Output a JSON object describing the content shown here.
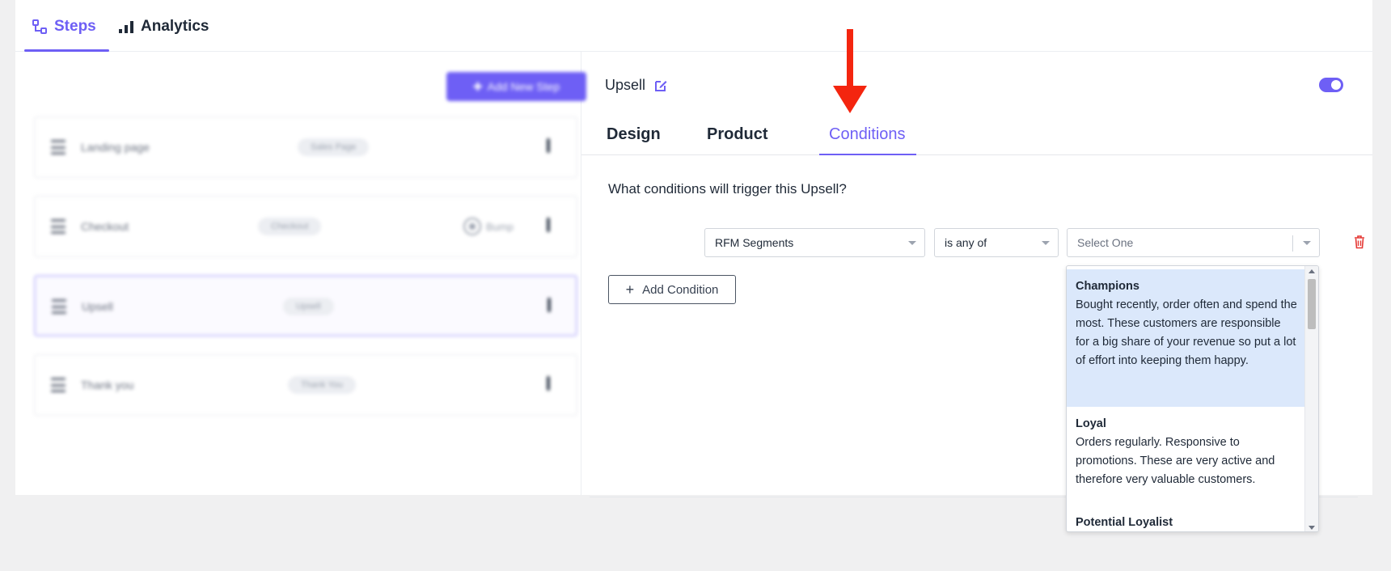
{
  "colors": {
    "accent": "#6e5ff5",
    "arrow": "#f4250f",
    "delete": "#e53935",
    "highlight": "#dbe8fb"
  },
  "topbar": {
    "tabs": [
      {
        "label": "Steps",
        "icon": "steps-icon",
        "active": true
      },
      {
        "label": "Analytics",
        "icon": "bar-chart-icon",
        "active": false
      }
    ]
  },
  "left_panel": {
    "add_step_label": "Add New Step",
    "steps": [
      {
        "name": "Landing page",
        "badge": "Sales Page"
      },
      {
        "name": "Checkout",
        "badge": "Checkout",
        "extra": "Bump"
      },
      {
        "name": "Upsell",
        "badge": "Upsell",
        "active": true
      },
      {
        "name": "Thank you",
        "badge": "Thank You"
      }
    ]
  },
  "right_panel": {
    "title": "Upsell",
    "tabs": [
      "Design",
      "Product",
      "Conditions"
    ],
    "active_tab": "Conditions",
    "question": "What conditions will trigger this Upsell?",
    "condition": {
      "field": "RFM Segments",
      "operator": "is any of",
      "value_placeholder": "Select One"
    },
    "add_condition_label": "Add Condition"
  },
  "dropdown": {
    "options": [
      {
        "title": "Champions",
        "desc": "Bought recently, order often and spend the most. These customers are responsible for a big share of your revenue so put a lot of effort into keeping them happy.",
        "highlighted": true
      },
      {
        "title": "Loyal",
        "desc": "Orders regularly. Responsive to promotions. These are very active and therefore very valuable customers.",
        "highlighted": false
      },
      {
        "title": "Potential Loyalist",
        "desc": "",
        "highlighted": false
      }
    ]
  }
}
